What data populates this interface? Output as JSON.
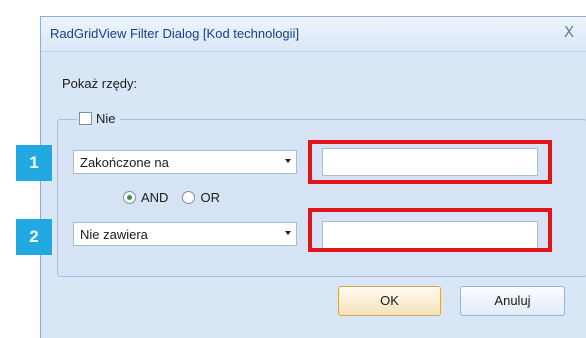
{
  "dialog": {
    "title": "RadGridView Filter Dialog [Kod technologii]",
    "close_glyph": "X",
    "show_rows_label": "Pokaż rzędy:",
    "negate_checkbox": {
      "label": "Nie",
      "checked": false
    },
    "filter1": {
      "operator": "Zakończone na",
      "value": ""
    },
    "filter2": {
      "operator": "Nie zawiera",
      "value": ""
    },
    "logic": {
      "and_label": "AND",
      "or_label": "OR",
      "selected": "AND"
    },
    "buttons": {
      "ok": "OK",
      "cancel": "Anuluj"
    }
  },
  "annotations": {
    "badge1": "1",
    "badge2": "2",
    "highlight_color": "#e0161c",
    "badge_color": "#23a9e1"
  }
}
